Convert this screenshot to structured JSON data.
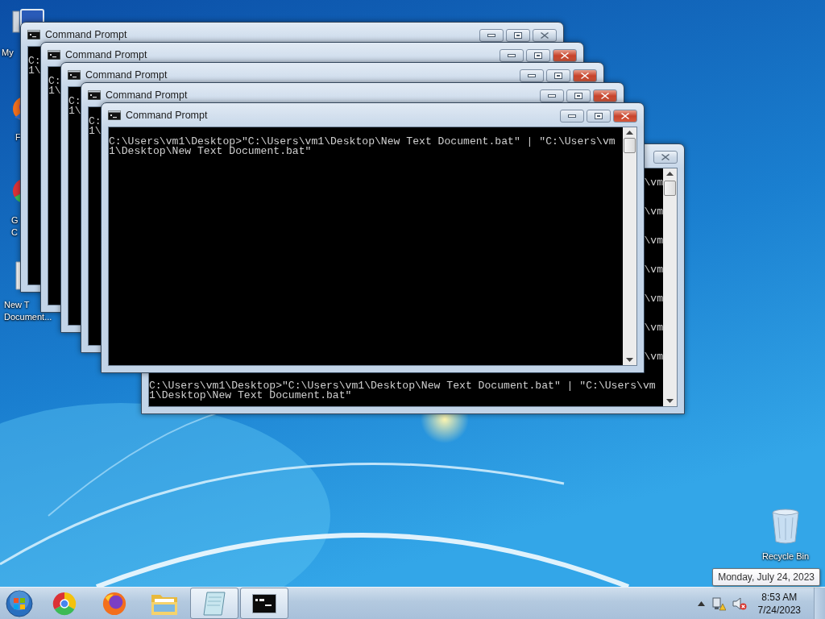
{
  "desktop_icons": [
    {
      "label_lines": [
        "My"
      ]
    },
    {
      "label_lines": [
        "F"
      ]
    },
    {
      "label_lines": [
        "G",
        "C"
      ]
    },
    {
      "label_lines": [
        "New T",
        "Document..."
      ]
    },
    {
      "label_lines": [
        "Recycle Bin"
      ]
    }
  ],
  "windows": [
    {
      "kind": "behind",
      "active": false,
      "console": [
        {
          "text": "\\vm",
          "kind": "tail"
        },
        {
          "text": "\\vm",
          "kind": "tail"
        },
        {
          "text": "\\vm",
          "kind": "tail"
        },
        {
          "text": "\\vm",
          "kind": "tail"
        },
        {
          "text": "\\vm",
          "kind": "tail"
        },
        {
          "text": "\\vm",
          "kind": "tail"
        },
        {
          "text": "\\vm",
          "kind": "tail"
        },
        {
          "text": "C:\\Users\\vm1\\Desktop>\"C:\\Users\\vm1\\Desktop\\New Text Document.bat\" | \"C:\\Users\\vm",
          "kind": "full"
        },
        {
          "text": "1\\Desktop\\New Text Document.bat\"",
          "kind": "full"
        }
      ]
    },
    {
      "title": "Command Prompt",
      "kind": "stacked",
      "active": false,
      "console": [
        {
          "text": "C:",
          "kind": "full"
        },
        {
          "text": "1\\",
          "kind": "full"
        }
      ]
    },
    {
      "title": "Command Prompt",
      "kind": "stacked",
      "active": true,
      "console": [
        {
          "text": "C:",
          "kind": "full"
        },
        {
          "text": "1\\",
          "kind": "full"
        }
      ]
    },
    {
      "title": "Command Prompt",
      "kind": "stacked",
      "active": true,
      "console": [
        {
          "text": "C:",
          "kind": "full"
        },
        {
          "text": "1\\",
          "kind": "full"
        }
      ]
    },
    {
      "title": "Command Prompt",
      "kind": "stacked",
      "active": true,
      "console": [
        {
          "text": "C:",
          "kind": "full"
        },
        {
          "text": "1\\",
          "kind": "full"
        }
      ]
    },
    {
      "title": "Command Prompt",
      "kind": "front",
      "active": true,
      "console": [
        {
          "text": "C:\\Users\\vm1\\Desktop>\"C:\\Users\\vm1\\Desktop\\New Text Document.bat\" | \"C:\\Users\\vm",
          "kind": "full"
        },
        {
          "text": "1\\Desktop\\New Text Document.bat\"",
          "kind": "full"
        }
      ]
    }
  ],
  "taskbar": {
    "buttons": [
      {
        "running": false
      },
      {
        "running": false
      },
      {
        "running": false
      },
      {
        "running": true
      },
      {
        "running": true
      }
    ],
    "clock": {
      "time": "8:53 AM",
      "date": "7/24/2023"
    }
  },
  "tooltip": {
    "text": "Monday, July 24, 2023"
  }
}
